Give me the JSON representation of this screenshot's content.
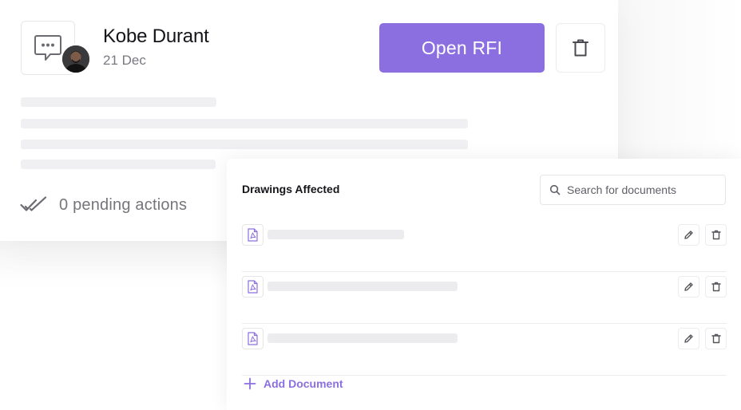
{
  "rfi": {
    "author_name": "Kobe Durant",
    "date": "21 Dec",
    "open_label": "Open RFI",
    "pending_text": "0 pending actions"
  },
  "documents": {
    "title": "Drawings Affected",
    "search_placeholder": "Search for documents",
    "add_label": "Add Document",
    "rows": [
      {
        "icon": "pdf-icon"
      },
      {
        "icon": "pdf-icon"
      },
      {
        "icon": "pdf-icon"
      }
    ]
  },
  "colors": {
    "accent": "#8b6fe0",
    "text_primary": "#15151a",
    "text_secondary": "#7a7a80",
    "border": "#e6e6e9",
    "skeleton": "#f0f0f2"
  }
}
